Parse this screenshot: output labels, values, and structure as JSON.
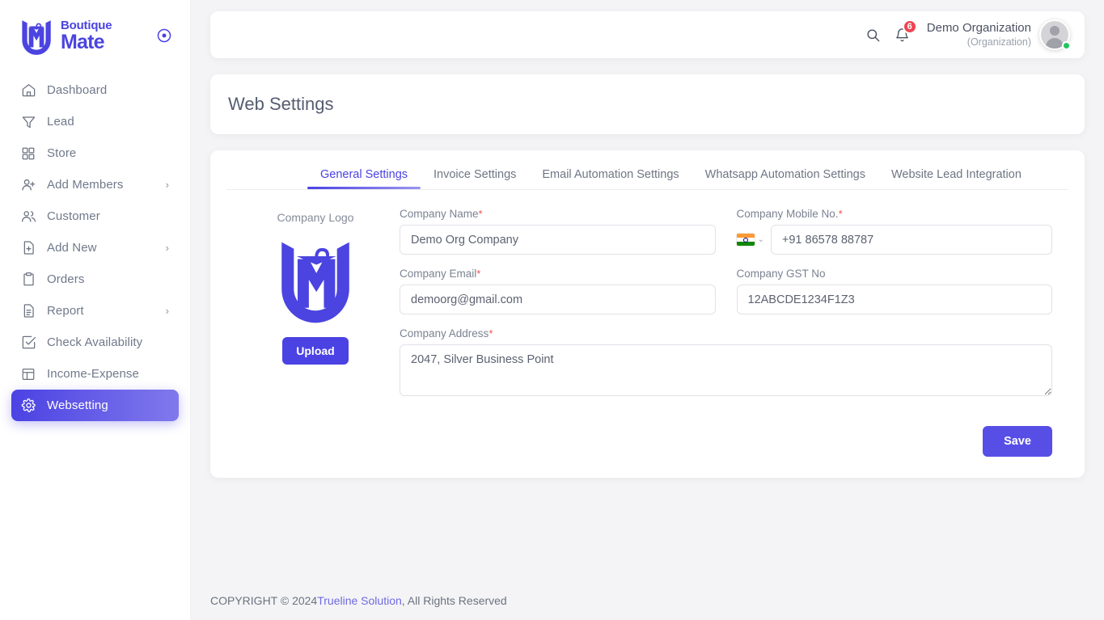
{
  "brand": {
    "line1": "Boutique",
    "line2": "Mate",
    "mark_icon": "lm-hanger-monogram-icon",
    "collapse_icon": "circle-target-icon",
    "accent": "#4b42e3"
  },
  "sidebar": {
    "items": [
      {
        "label": "Dashboard",
        "icon": "home-icon",
        "chevron": "",
        "active": false
      },
      {
        "label": "Lead",
        "icon": "funnel-icon",
        "chevron": "",
        "active": false
      },
      {
        "label": "Store",
        "icon": "grid-icon",
        "chevron": "",
        "active": false
      },
      {
        "label": "Add Members",
        "icon": "user-plus-icon",
        "chevron": "›",
        "active": false
      },
      {
        "label": "Customer",
        "icon": "users-icon",
        "chevron": "",
        "active": false
      },
      {
        "label": "Add New",
        "icon": "file-plus-icon",
        "chevron": "›",
        "active": false
      },
      {
        "label": "Orders",
        "icon": "clipboard-icon",
        "chevron": "",
        "active": false
      },
      {
        "label": "Report",
        "icon": "document-icon",
        "chevron": "›",
        "active": false
      },
      {
        "label": "Check Availability",
        "icon": "check-square-icon",
        "chevron": "",
        "active": false
      },
      {
        "label": "Income-Expense",
        "icon": "layout-icon",
        "chevron": "",
        "active": false
      },
      {
        "label": "Websetting",
        "icon": "gear-icon",
        "chevron": "",
        "active": true
      }
    ]
  },
  "header": {
    "search_icon": "search-icon",
    "bell_icon": "bell-icon",
    "notification_count": "6",
    "org_name": "Demo Organization",
    "org_role": "(Organization)",
    "avatar_icon": "user-avatar-icon",
    "status": "online",
    "badge_color": "#ef4452",
    "status_color": "#22c55e"
  },
  "page": {
    "title": "Web Settings"
  },
  "tabs": [
    {
      "label": "General Settings",
      "active": true
    },
    {
      "label": "Invoice Settings",
      "active": false
    },
    {
      "label": "Email Automation Settings",
      "active": false
    },
    {
      "label": "Whatsapp Automation Settings",
      "active": false
    },
    {
      "label": "Website Lead Integration",
      "active": false
    }
  ],
  "form": {
    "logo": {
      "label": "Company Logo",
      "image_icon": "company-logo-image",
      "upload_label": "Upload"
    },
    "company_name": {
      "label": "Company Name",
      "required": "*",
      "value": "Demo Org Company",
      "placeholder": "Company Name"
    },
    "company_mobile": {
      "label": "Company Mobile No.",
      "required": "*",
      "value": "+91 86578 88787",
      "placeholder": "Company Mobile No.",
      "country_flag": "india-flag-icon",
      "caret": "⌄"
    },
    "company_email": {
      "label": "Company Email",
      "required": "*",
      "value": "demoorg@gmail.com",
      "placeholder": "Company Email"
    },
    "company_gst": {
      "label": "Company GST No",
      "required": "",
      "value": "12ABCDE1234F1Z3",
      "placeholder": "Company GST No"
    },
    "company_address": {
      "label": "Company Address",
      "required": "*",
      "value": "2047, Silver Business Point",
      "placeholder": "Company Address"
    },
    "save_label": "Save"
  },
  "footer": {
    "prefix": "COPYRIGHT © 2024 ",
    "link": "Trueline Solution",
    "suffix": ", All Rights Reserved"
  }
}
